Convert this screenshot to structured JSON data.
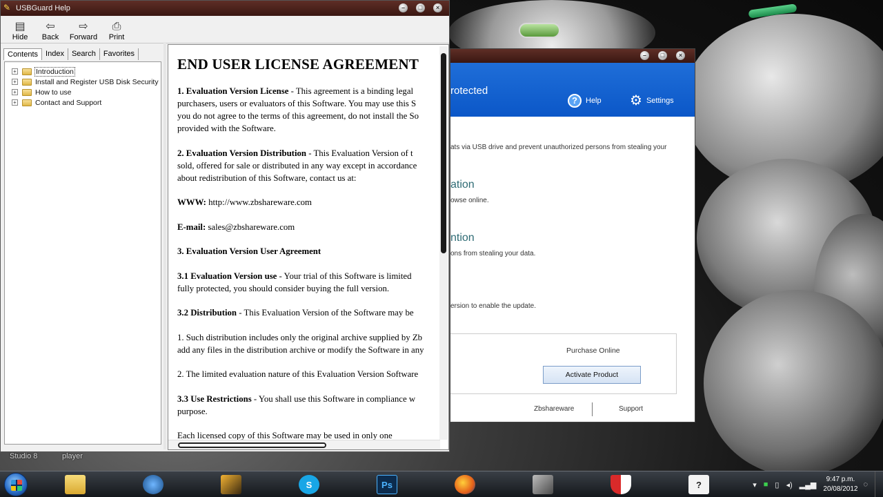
{
  "help_window": {
    "title": "USBGuard Help",
    "toolbar": [
      {
        "label": "Hide",
        "icon": "hide-icon"
      },
      {
        "label": "Back",
        "icon": "back-arrow-icon"
      },
      {
        "label": "Forward",
        "icon": "forward-arrow-icon"
      },
      {
        "label": "Print",
        "icon": "printer-icon"
      }
    ],
    "tabs": [
      "Contents",
      "Index",
      "Search",
      "Favorites"
    ],
    "toc": [
      "Introduction",
      "Install and Register USB Disk Security",
      "How to use",
      "Contact and Support"
    ],
    "doc": {
      "title": "END USER LICENSE AGREEMENT",
      "p1_bold": "1. Evaluation Version License",
      "p1_l1": " - This agreement is a binding legal",
      "p1_l2": "purchasers, users or evaluators of this Software. You may use this S",
      "p1_l3": "you do not agree to the terms of this agreement, do not install the So",
      "p1_l4": "provided with the Software.",
      "p2_bold": "2. Evaluation Version Distribution",
      "p2_l1": " - This Evaluation Version of t",
      "p2_l2": "sold, offered for sale or distributed in any way except in accordance",
      "p2_l3": "about redistribution of this Software, contact us at:",
      "www_label": "WWW:",
      "www_value": " http://www.zbshareware.com",
      "email_label": "E-mail:",
      "email_value": " sales@zbshareware.com",
      "s3": "3. Evaluation Version User Agreement",
      "s31_bold": "3.1 Evaluation Version use",
      "s31_l1": " - Your trial of this Software is limited",
      "s31_l2": "fully protected, you should consider buying the full version.",
      "s32_bold": "3.2 Distribution",
      "s32_l1": " - This Evaluation Version of the Software may be",
      "s32a_l1": "1. Such distribution includes only the original archive supplied by Zb",
      "s32a_l2": "add any files in the distribution archive or modify the Software in any",
      "s32b": "2. The limited evaluation nature of this Evaluation Version Software",
      "s33_bold": "3.3 Use Restrictions",
      "s33_l1": " - You shall use this Software in compliance w",
      "s33_l2": "purpose.",
      "cutoff": "Each licensed copy of this Software may be used in only one"
    }
  },
  "usb_window": {
    "status": "rotected",
    "help_label": "Help",
    "settings_label": "Settings",
    "line1": "ats via USB drive and prevent unauthorized persons from stealing your",
    "heading1": "ation",
    "line2": "owse online.",
    "heading2": "ntion",
    "line3": "ons from stealing your data.",
    "line4": "ersion to enable the update.",
    "purchase": "Purchase Online",
    "activate": "Activate Product",
    "footer_left": "Zbshareware",
    "footer_right": "Support"
  },
  "desktop": {
    "labels": [
      "Studio 8",
      "player"
    ]
  },
  "taskbar": {
    "apps": [
      "windows-explorer-icon",
      "network-globe-icon",
      "winamp-icon",
      "skype-icon",
      "photoshop-icon",
      "firefox-icon",
      "camtasia-icon",
      "usb-disk-security-icon",
      "help-file-icon"
    ],
    "ps_label": "Ps",
    "time": "9:47 p.m.",
    "date": "20/08/2012"
  }
}
